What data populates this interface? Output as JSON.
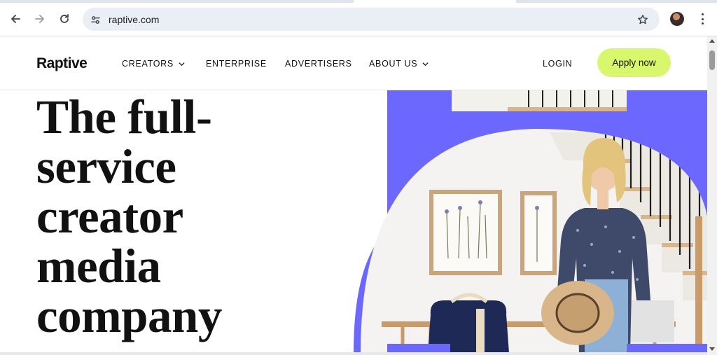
{
  "browser": {
    "url": "raptive.com",
    "icons": {
      "back": "arrow-left-icon",
      "forward": "arrow-right-icon",
      "reload": "reload-icon",
      "site_info": "tune-icon",
      "bookmark": "star-icon",
      "menu": "kebab-menu-icon"
    }
  },
  "site": {
    "logo": "Raptive",
    "nav": [
      {
        "label": "CREATORS",
        "has_dropdown": true
      },
      {
        "label": "ENTERPRISE",
        "has_dropdown": false
      },
      {
        "label": "ADVERTISERS",
        "has_dropdown": false
      },
      {
        "label": "ABOUT US",
        "has_dropdown": true
      }
    ],
    "login": "LOGIN",
    "cta": "Apply now"
  },
  "hero": {
    "title_lines": [
      "The full-",
      "service",
      "creator",
      "media",
      "company"
    ]
  },
  "colors": {
    "accent_purple": "#6c67ff",
    "cta_green": "#d9f76c",
    "text": "#111111"
  }
}
